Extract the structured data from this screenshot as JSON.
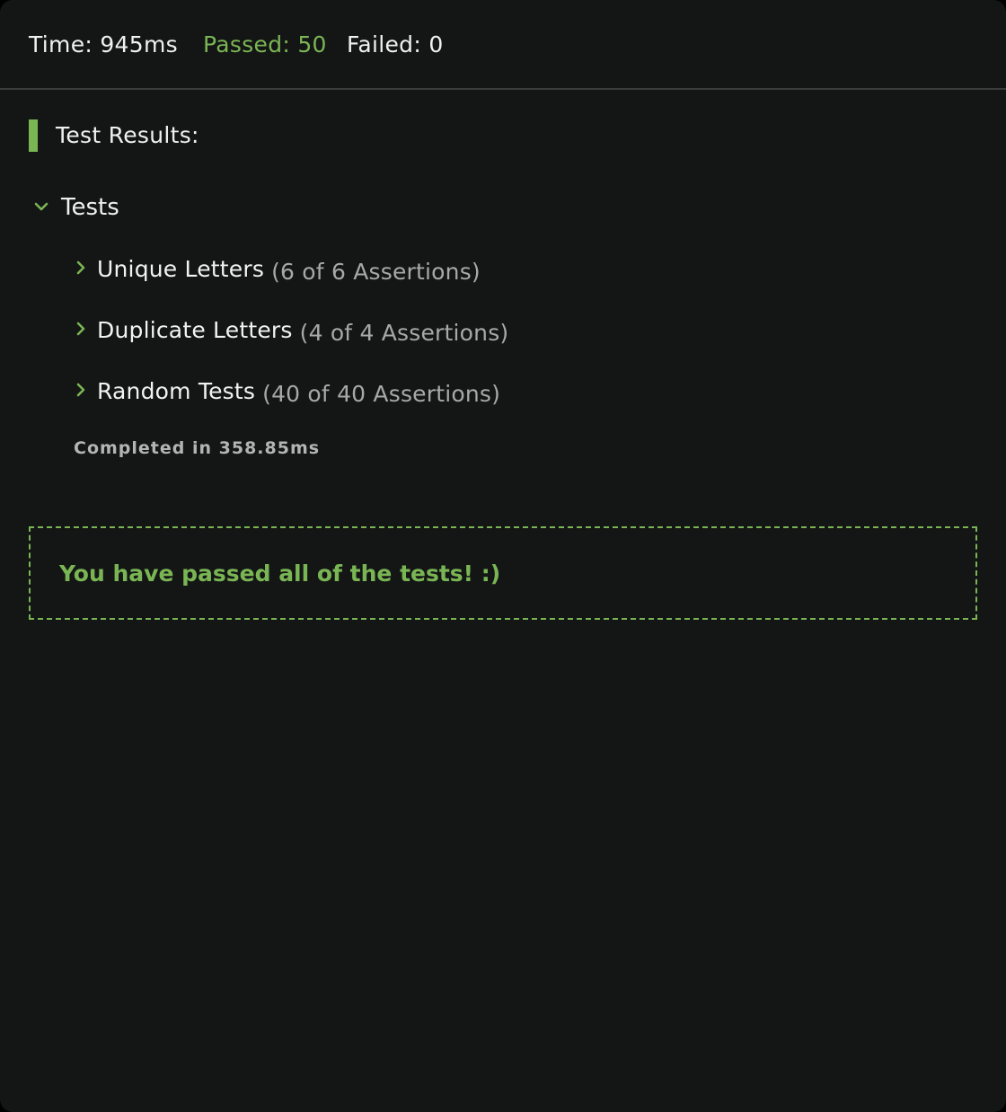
{
  "colors": {
    "accent_green": "#7ab554",
    "background": "#141616",
    "muted_text": "#a8a8a8"
  },
  "stats": {
    "time": "Time: 945ms",
    "passed": "Passed: 50",
    "failed": "Failed: 0"
  },
  "results": {
    "title": "Test Results:",
    "group": {
      "label": "Tests",
      "icon": "chevron-down-icon",
      "items": [
        {
          "name": "Unique Letters",
          "count": "(6 of 6 Assertions)",
          "icon": "chevron-right-icon"
        },
        {
          "name": "Duplicate Letters",
          "count": "(4 of 4 Assertions)",
          "icon": "chevron-right-icon"
        },
        {
          "name": "Random Tests",
          "count": "(40 of 40 Assertions)",
          "icon": "chevron-right-icon"
        }
      ]
    },
    "completed": "Completed in 358.85ms"
  },
  "pass_message": "You have passed all of the tests! :)"
}
